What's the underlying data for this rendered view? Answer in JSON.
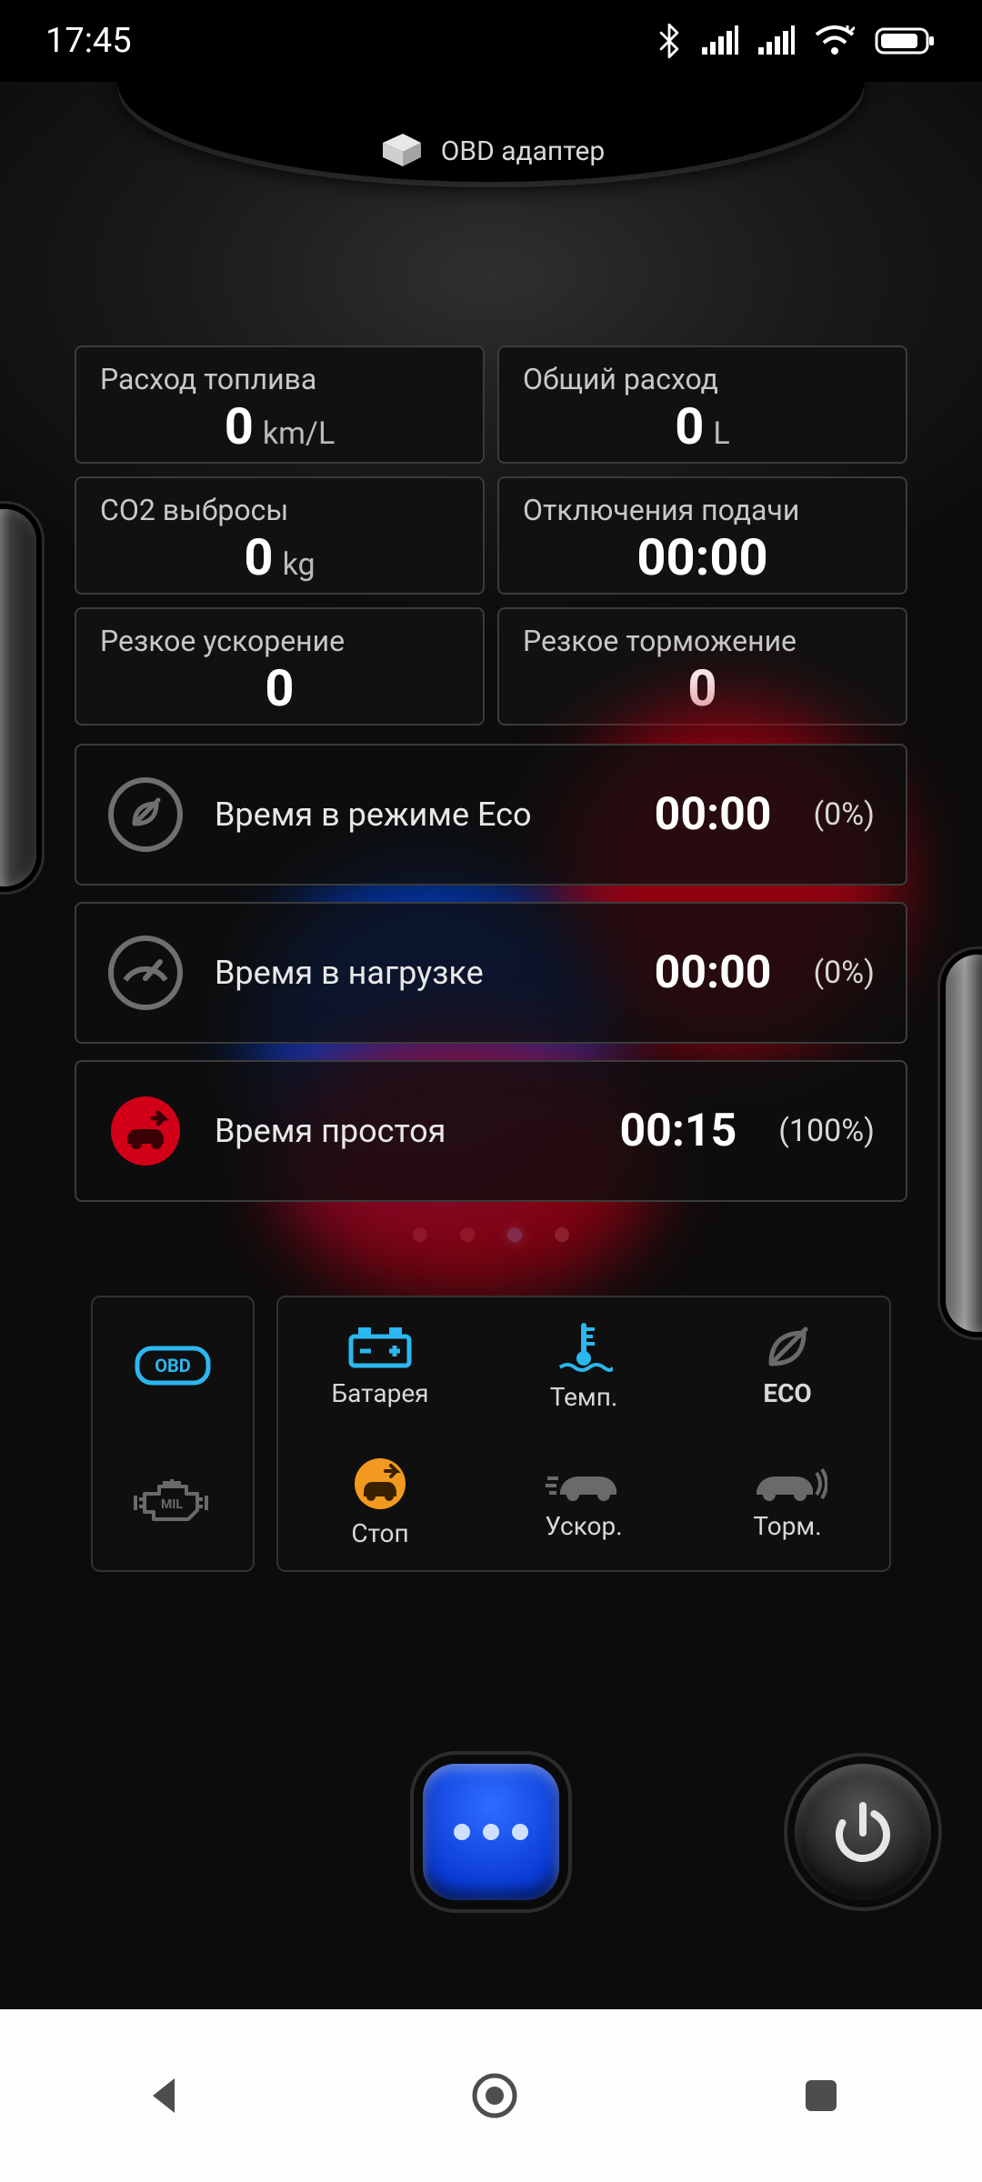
{
  "statusbar": {
    "time": "17:45"
  },
  "header": {
    "title": "OBD адаптер"
  },
  "tiles": [
    {
      "label": "Расход топлива",
      "value": "0",
      "unit": "km/L"
    },
    {
      "label": "Общий расход",
      "value": "0",
      "unit": "L"
    },
    {
      "label": "CO2 выбросы",
      "value": "0",
      "unit": "kg"
    },
    {
      "label": "Отключения подачи",
      "value": "00:00",
      "unit": ""
    },
    {
      "label": "Резкое ускорение",
      "value": "0",
      "unit": ""
    },
    {
      "label": "Резкое торможение",
      "value": "0",
      "unit": ""
    }
  ],
  "timebars": [
    {
      "label": "Время в режиме Eco",
      "time": "00:00",
      "pct": "(0%)"
    },
    {
      "label": "Время в нагрузке",
      "time": "00:00",
      "pct": "(0%)"
    },
    {
      "label": "Время простоя",
      "time": "00:15",
      "pct": "(100%)"
    }
  ],
  "pager": {
    "count": 4,
    "active_index": 2
  },
  "toolbar": {
    "obd": "OBD",
    "mil": "MIL",
    "battery": "Батарея",
    "temp": "Темп.",
    "eco": "ECO",
    "stop": "Стоп",
    "accel": "Ускор.",
    "brake": "Торм."
  }
}
